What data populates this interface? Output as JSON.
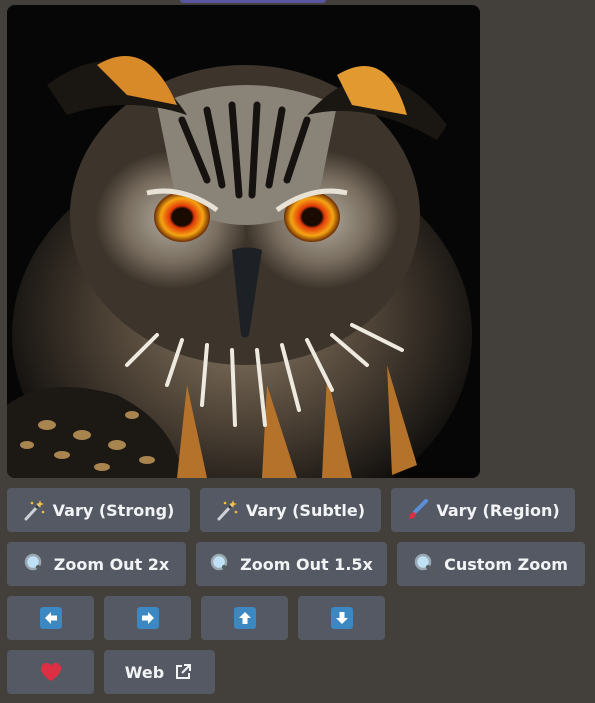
{
  "image": {
    "subject_icon": "owl-image"
  },
  "buttons": {
    "row1": [
      {
        "label": "Vary (Strong)",
        "icon": "magic-wand-icon"
      },
      {
        "label": "Vary (Subtle)",
        "icon": "magic-wand-icon"
      },
      {
        "label": "Vary (Region)",
        "icon": "paintbrush-icon"
      }
    ],
    "row2": [
      {
        "label": "Zoom Out 2x",
        "icon": "magnifier-icon"
      },
      {
        "label": "Zoom Out 1.5x",
        "icon": "magnifier-icon"
      },
      {
        "label": "Custom Zoom",
        "icon": "magnifier-icon"
      }
    ],
    "row3": [
      {
        "icon": "arrow-left-icon"
      },
      {
        "icon": "arrow-right-icon"
      },
      {
        "icon": "arrow-up-icon"
      },
      {
        "icon": "arrow-down-icon"
      }
    ],
    "row4": [
      {
        "icon": "heart-icon"
      },
      {
        "label": "Web",
        "icon": "external-link-icon"
      }
    ]
  },
  "colors": {
    "background": "#433f3a",
    "button": "#545963",
    "arrow_blue": "#3b88c3",
    "heart_red": "#dd2e44"
  }
}
